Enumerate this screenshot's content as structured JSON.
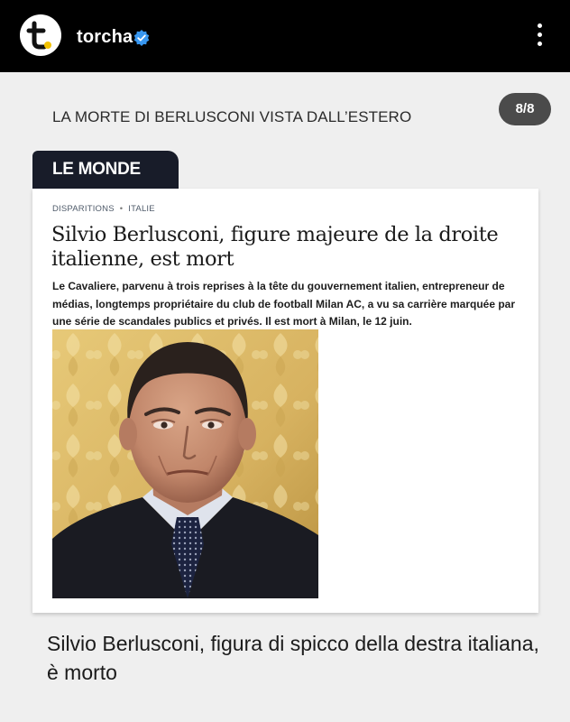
{
  "account": {
    "name": "torcha",
    "logo_letter": "t",
    "logo_dot_color": "#f2c200",
    "verified_icon": "verified-badge-icon",
    "menu_icon": "more-vertical-icon"
  },
  "post": {
    "header": "LA MORTE DI BERLUSCONI VISTA DALL’ESTERO",
    "counter": "8/8",
    "caption": "Silvio Berlusconi, figura di spicco della destra italiana, è morto"
  },
  "clipping": {
    "source_label": "LE MONDE",
    "kicker_section": "DISPARITIONS",
    "kicker_separator": "•",
    "kicker_topic": "ITALIE",
    "headline": "Silvio Berlusconi, figure majeure de la droite italienne, est mort",
    "lede": "Le Cavaliere, parvenu à trois reprises à la tête du gouvernement italien, entrepreneur de médias, longtemps propriétaire du club de football Milan AC, a vu sa carrière marquée par une série de scandales publics et privés. Il est mort à Milan, le 12 juin."
  },
  "colors": {
    "topbar": "#000000",
    "background": "#efefef",
    "tab": "#181c29",
    "verified": "#3897f0",
    "counter_bg": "#4b4b4b"
  }
}
